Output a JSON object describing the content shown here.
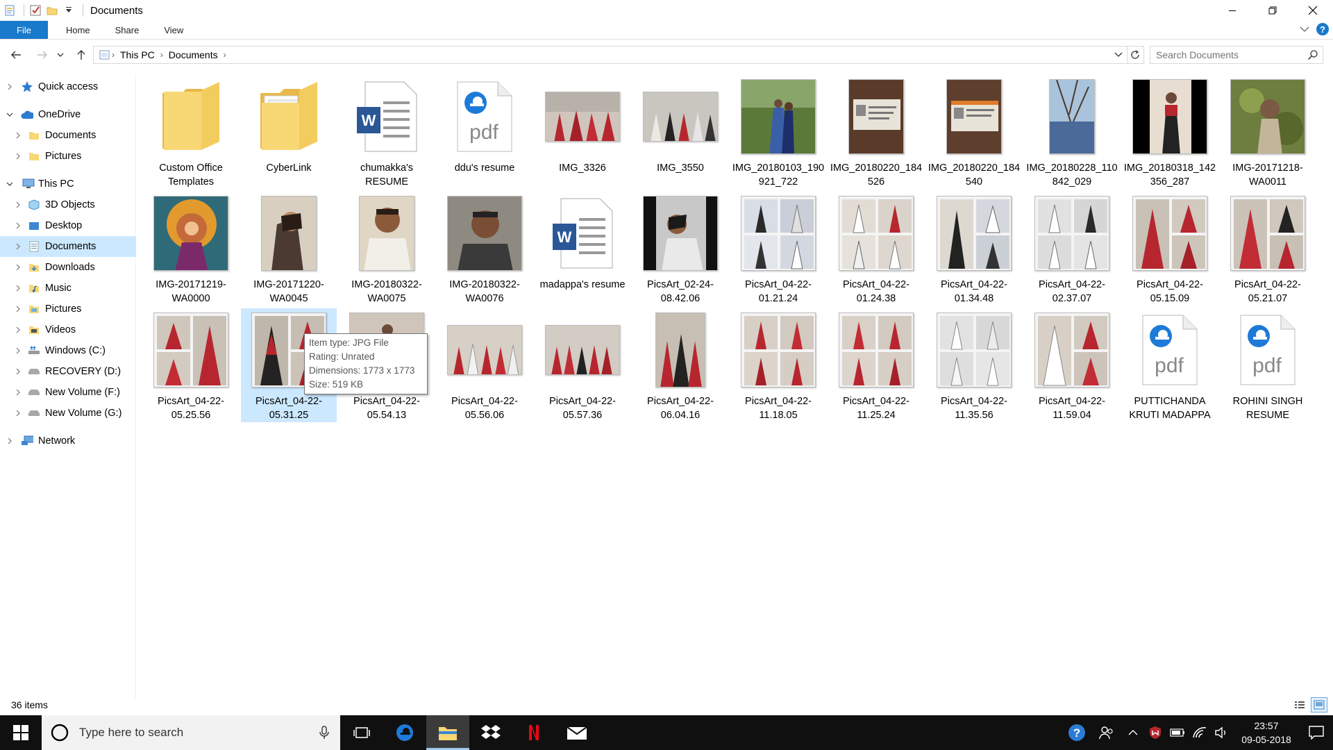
{
  "window": {
    "title": "Documents"
  },
  "ribbon": {
    "file": "File",
    "home": "Home",
    "share": "Share",
    "view": "View"
  },
  "address": {
    "crumbs": [
      "This PC",
      "Documents"
    ]
  },
  "search": {
    "placeholder": "Search Documents"
  },
  "nav": {
    "quick_access": "Quick access",
    "onedrive": "OneDrive",
    "onedrive_documents": "Documents",
    "onedrive_pictures": "Pictures",
    "this_pc": "This PC",
    "objects3d": "3D Objects",
    "desktop": "Desktop",
    "documents": "Documents",
    "downloads": "Downloads",
    "music": "Music",
    "pictures": "Pictures",
    "videos": "Videos",
    "drive_c": "Windows (C:)",
    "drive_d": "RECOVERY (D:)",
    "drive_f": "New Volume (F:)",
    "drive_g": "New Volume (G:)",
    "network": "Network"
  },
  "files": [
    "Custom Office Templates",
    "CyberLink",
    "chumakka's RESUME",
    "ddu's resume",
    "IMG_3326",
    "IMG_3550",
    "IMG_20180103_190921_722",
    "IMG_20180220_184526",
    "IMG_20180220_184540",
    "IMG_20180228_110842_029",
    "IMG_20180318_142356_287",
    "IMG-20171218-WA0011",
    "IMG-20171219-WA0000",
    "IMG-20171220-WA0045",
    "IMG-20180322-WA0075",
    "IMG-20180322-WA0076",
    "madappa's resume",
    "PicsArt_02-24-08.42.06",
    "PicsArt_04-22-01.21.24",
    "PicsArt_04-22-01.24.38",
    "PicsArt_04-22-01.34.48",
    "PicsArt_04-22-02.37.07",
    "PicsArt_04-22-05.15.09",
    "PicsArt_04-22-05.21.07",
    "PicsArt_04-22-05.25.56",
    "PicsArt_04-22-05.31.25",
    "PicsArt_04-22-05.54.13",
    "PicsArt_04-22-05.56.06",
    "PicsArt_04-22-05.57.36",
    "PicsArt_04-22-06.04.16",
    "PicsArt_04-22-11.18.05",
    "PicsArt_04-22-11.25.24",
    "PicsArt_04-22-11.35.56",
    "PicsArt_04-22-11.59.04",
    "PUTTICHANDA KRUTI MADAPPA",
    "ROHINI SINGH RESUME"
  ],
  "tooltip": {
    "type": "Item type: JPG File",
    "rating": "Rating: Unrated",
    "dimensions": "Dimensions: 1773 x 1773",
    "size": "Size: 519 KB"
  },
  "status": {
    "count": "36 items"
  },
  "taskbar": {
    "search_placeholder": "Type here to search",
    "time": "23:57",
    "date": "09-05-2018"
  },
  "colors": {
    "accent": "#1979ca",
    "selection": "#cce8ff",
    "folder": "#f8d775",
    "red_dress": "#b7262f",
    "taskbar": "#101010"
  },
  "icons": [
    "back-arrow-icon",
    "forward-arrow-icon",
    "up-arrow-icon",
    "refresh-icon",
    "search-icon",
    "folder-icon",
    "word-doc-icon",
    "edge-pdf-icon",
    "windows-start-icon",
    "cortana-icon",
    "microphone-icon",
    "task-view-icon",
    "edge-icon",
    "file-explorer-icon",
    "dropbox-icon",
    "netflix-icon",
    "mail-icon"
  ]
}
